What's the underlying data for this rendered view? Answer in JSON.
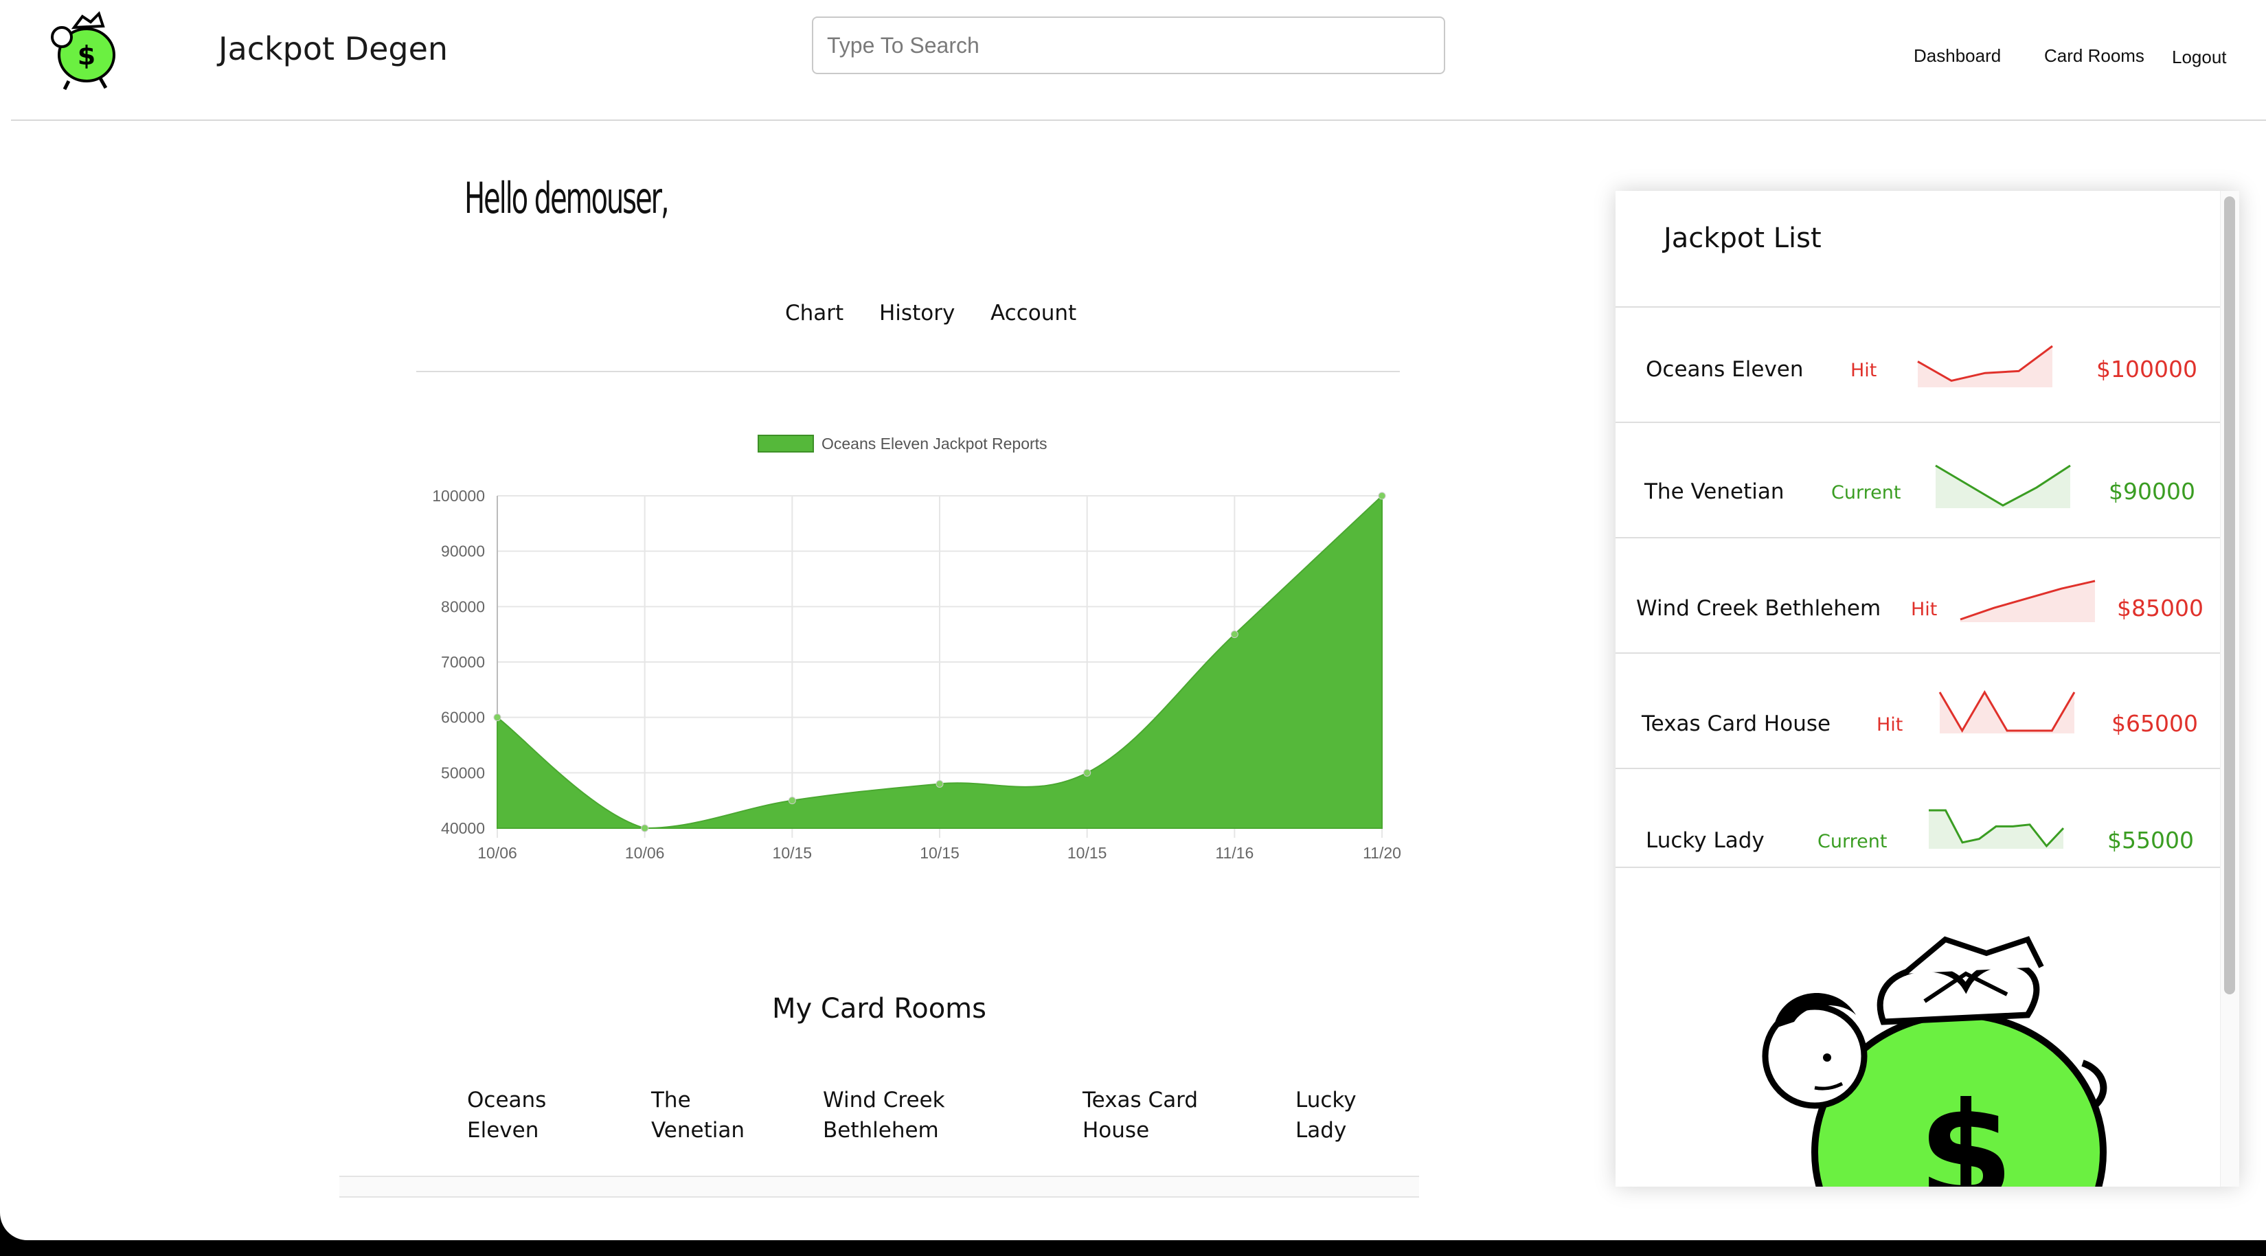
{
  "header": {
    "brand": "Jackpot Degen",
    "search_placeholder": "Type To Search",
    "nav": {
      "dashboard": "Dashboard",
      "card_rooms": "Card Rooms",
      "logout": "Logout"
    }
  },
  "main": {
    "greeting": "Hello demouser,",
    "tabs": [
      "Chart",
      "History",
      "Account"
    ],
    "rooms_title": "My Card Rooms",
    "rooms": [
      [
        "Oceans",
        "Eleven"
      ],
      [
        "The",
        "Venetian"
      ],
      [
        "Wind Creek",
        "Bethlehem"
      ],
      [
        "Texas Card",
        "House"
      ],
      [
        "Lucky",
        "Lady"
      ]
    ]
  },
  "chart_data": {
    "type": "area",
    "legend": "Oceans Eleven Jackpot Reports",
    "legend_position": "top",
    "x": [
      "10/06",
      "10/06",
      "10/15",
      "10/15",
      "10/15",
      "11/16",
      "11/20"
    ],
    "values": [
      60000,
      40000,
      45000,
      48000,
      50000,
      75000,
      100000
    ],
    "ylim": [
      40000,
      100000
    ],
    "yticks": [
      "100000",
      "90000",
      "80000",
      "70000",
      "60000",
      "50000",
      "40000"
    ],
    "grid": true,
    "color": "#55b83a"
  },
  "jackpot_list": {
    "title": "Jackpot List",
    "items": [
      {
        "name": "Oceans Eleven",
        "status": "Hit",
        "amount": "$100000",
        "color": "#e0312b",
        "spark": [
          0.6,
          0.1,
          0.3,
          0.35,
          1.0
        ]
      },
      {
        "name": "The Venetian",
        "status": "Current",
        "amount": "$90000",
        "color": "#3a9d22",
        "spark": [
          1.0,
          0.5,
          0.0,
          0.45,
          1.0
        ]
      },
      {
        "name": "Wind Creek Bethlehem",
        "status": "Hit",
        "amount": "$85000",
        "color": "#e0312b",
        "spark": [
          0.0,
          0.3,
          0.55,
          0.8,
          1.0
        ]
      },
      {
        "name": "Texas Card House",
        "status": "Hit",
        "amount": "$65000",
        "color": "#e0312b",
        "spark": [
          1.0,
          0.0,
          1.0,
          0.0,
          0.0,
          0.0,
          1.0
        ]
      },
      {
        "name": "Lucky Lady",
        "status": "Current",
        "amount": "$55000",
        "color": "#3a9d22",
        "spark": [
          1.0,
          1.0,
          0.1,
          0.2,
          0.55,
          0.55,
          0.6,
          0.0,
          0.5
        ]
      }
    ]
  },
  "icons": {
    "logo": "money-bag-mascot-icon",
    "mascot": "money-bag-mascot-illustration"
  },
  "colors": {
    "brand_green": "#6bf041",
    "hit_red": "#e0312b",
    "current_green": "#3a9d22"
  }
}
